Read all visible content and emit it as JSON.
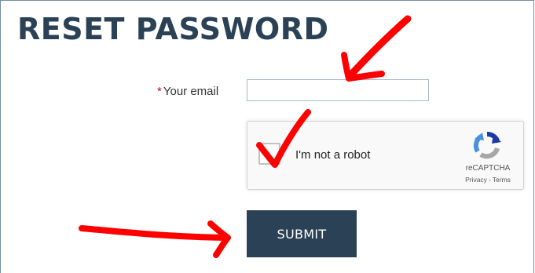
{
  "page": {
    "title": "RESET PASSWORD"
  },
  "form": {
    "email": {
      "required_mark": "*",
      "label": "Your email",
      "value": "",
      "placeholder": ""
    },
    "captcha": {
      "checkbox_label": "I'm not a robot",
      "brand": "reCAPTCHA",
      "privacy_link": "Privacy",
      "separator": "-",
      "terms_link": "Terms",
      "checked": false
    },
    "submit_label": "SUBMIT"
  },
  "colors": {
    "heading": "#2b4256",
    "button_bg": "#2b4256",
    "required_star": "#d0021b",
    "annotation_marks": "#ff0000"
  },
  "annotations": [
    {
      "kind": "arrow",
      "points_to": "email-input"
    },
    {
      "kind": "checkmark",
      "points_to": "recaptcha-checkbox"
    },
    {
      "kind": "arrow",
      "points_to": "submit-button"
    }
  ]
}
